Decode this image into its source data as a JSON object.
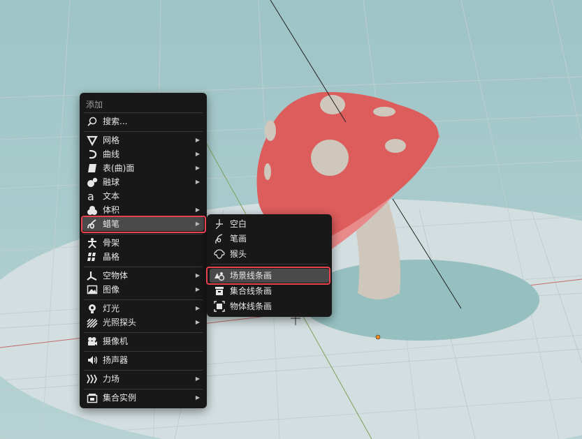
{
  "add_menu": {
    "title": "添加",
    "items": [
      {
        "label": "搜索...",
        "icon": "search-icon",
        "submenu": false
      },
      {
        "label": "网格",
        "icon": "mesh-icon",
        "submenu": true
      },
      {
        "label": "曲线",
        "icon": "curve-icon",
        "submenu": true
      },
      {
        "label": "表(曲)面",
        "icon": "surface-icon",
        "submenu": true
      },
      {
        "label": "融球",
        "icon": "metaball-icon",
        "submenu": true
      },
      {
        "label": "文本",
        "icon": "text-icon",
        "submenu": false
      },
      {
        "label": "体积",
        "icon": "volume-icon",
        "submenu": true
      },
      {
        "label": "蜡笔",
        "icon": "grease-pencil-icon",
        "submenu": true,
        "active": true,
        "highlighted": true
      },
      {
        "label": "骨架",
        "icon": "armature-icon",
        "submenu": false
      },
      {
        "label": "晶格",
        "icon": "lattice-icon",
        "submenu": false
      },
      {
        "label": "空物体",
        "icon": "empty-icon",
        "submenu": true
      },
      {
        "label": "图像",
        "icon": "image-icon",
        "submenu": true
      },
      {
        "label": "灯光",
        "icon": "light-icon",
        "submenu": true
      },
      {
        "label": "光照探头",
        "icon": "light-probe-icon",
        "submenu": true
      },
      {
        "label": "摄像机",
        "icon": "camera-icon",
        "submenu": false
      },
      {
        "label": "扬声器",
        "icon": "speaker-icon",
        "submenu": false
      },
      {
        "label": "力场",
        "icon": "force-field-icon",
        "submenu": true
      },
      {
        "label": "集合实例",
        "icon": "collection-instance-icon",
        "submenu": true
      }
    ]
  },
  "grease_pencil_submenu": {
    "items": [
      {
        "label": "空白",
        "icon": "blank-stroke-icon"
      },
      {
        "label": "笔画",
        "icon": "stroke-icon"
      },
      {
        "label": "猴头",
        "icon": "monkey-icon"
      },
      {
        "label": "场景线条画",
        "icon": "scene-lineart-icon",
        "active": true,
        "highlighted": true
      },
      {
        "label": "集合线条画",
        "icon": "collection-lineart-icon"
      },
      {
        "label": "物体线条画",
        "icon": "object-lineart-icon"
      }
    ]
  },
  "colors": {
    "menu_bg": "#181818",
    "highlight_border": "#e8424f",
    "active_item_bg": "#4a4a4a",
    "viewport_bg": "#a9caca",
    "mushroom_cap": "#dd5c5c",
    "mushroom_stem": "#cfc6bc"
  },
  "submenu_arrow": "▶"
}
